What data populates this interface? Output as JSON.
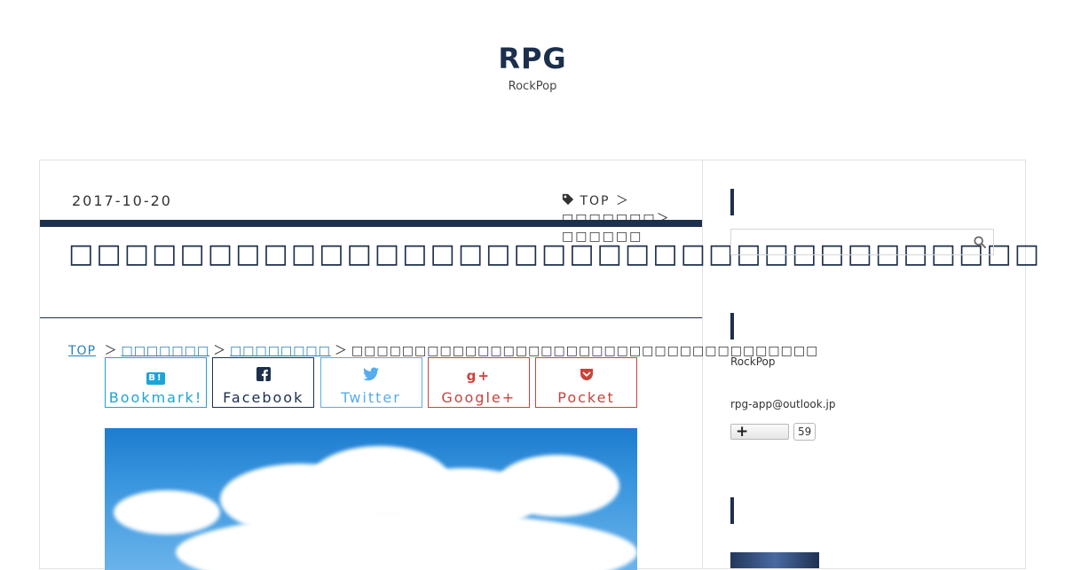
{
  "site": {
    "title": "RPG",
    "subtitle": "RockPop"
  },
  "post": {
    "date": "2017-10-20",
    "category_path": [
      "TOP",
      "＞",
      "□□□□□□□",
      "＞",
      "□□□□□□"
    ],
    "title": "□□□□□□□□□□□□□□□□□□□□□□□□□□□□□□□□□□□",
    "breadcrumb": {
      "top": "TOP",
      "sep": "＞",
      "level1": "□□□□□□□",
      "level2": "□□□□□□□□",
      "current": "□□□□□□□□□□□□□□□□□□□□□□□□□□□□□□□□□□□□□"
    }
  },
  "share": {
    "hatena": {
      "icon": "B!",
      "label": "Bookmark!",
      "color": "#1ba5d8"
    },
    "facebook": {
      "label": "Facebook",
      "color": "#1c2f4d"
    },
    "twitter": {
      "label": "Twitter",
      "color": "#55acee"
    },
    "gplus": {
      "icon": "g+",
      "label": "Google+",
      "color": "#c9433a"
    },
    "pocket": {
      "label": "Pocket",
      "color": "#c9433a"
    }
  },
  "sidebar": {
    "author": "RockPop",
    "email": "rpg-app@outlook.jp",
    "follow_count": "59",
    "search_placeholder": ""
  },
  "colors": {
    "accent": "#1c2f4d",
    "link": "#2a7fb8"
  }
}
